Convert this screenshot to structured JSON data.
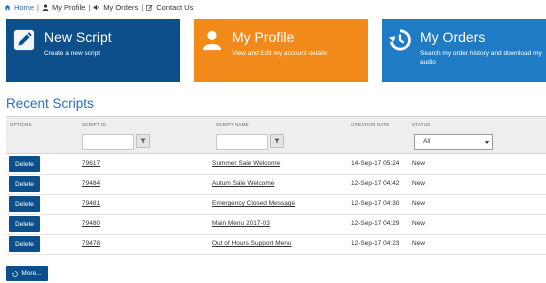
{
  "topnav": {
    "home": "Home",
    "profile": "My Profile",
    "orders": "My Orders",
    "contact": "Contact Us",
    "separator": "|"
  },
  "tiles": {
    "new_script": {
      "title": "New Script",
      "subtitle": "Create a new script",
      "icon": "pencil-icon"
    },
    "my_profile": {
      "title": "My Profile",
      "subtitle": "View and Edit my account details",
      "icon": "user-icon"
    },
    "my_orders": {
      "title": "My Orders",
      "subtitle": "Search my order history and download my audio",
      "icon": "history-icon"
    }
  },
  "recent": {
    "heading": "Recent Scripts",
    "columns": {
      "options": "OPTIONS",
      "script_id": "SCRIPT ID",
      "script_name": "SCRIPT NAME",
      "creation_date": "CREATION DATE",
      "status": "STATUS"
    },
    "filters": {
      "script_id": "",
      "script_name": "",
      "status_selected": "All"
    },
    "delete_label": "Delete",
    "rows": [
      {
        "id": "79617",
        "name": "Summer Sale Welcome",
        "date": "14-Sep-17 05:24",
        "status": "New"
      },
      {
        "id": "79484",
        "name": "Autum Sale Welcome",
        "date": "12-Sep-17 04:42",
        "status": "New"
      },
      {
        "id": "79481",
        "name": "Emergency Closed Message",
        "date": "12-Sep-17 04:30",
        "status": "New"
      },
      {
        "id": "79480",
        "name": "Main Menu 2017-03",
        "date": "12-Sep-17 04:29",
        "status": "New"
      },
      {
        "id": "79478",
        "name": "Out of Hours Support Menu",
        "date": "12-Sep-17 04:23",
        "status": "New"
      }
    ],
    "more_label": "More..."
  },
  "colors": {
    "dark_blue": "#0d4f8b",
    "orange": "#f28a1b",
    "light_blue": "#1f7cc4",
    "heading_blue": "#2a6ebb"
  }
}
